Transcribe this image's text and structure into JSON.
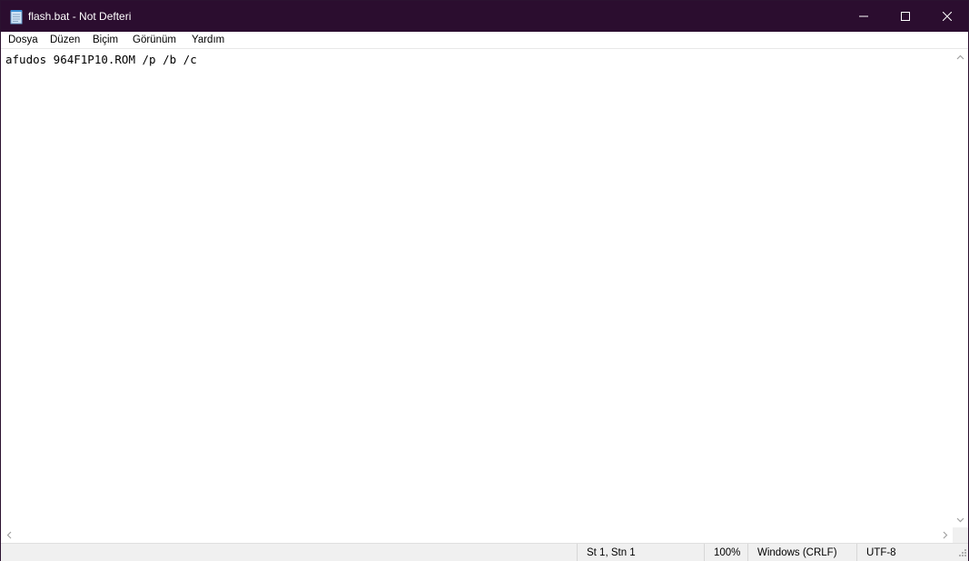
{
  "window": {
    "title": "flash.bat - Not Defteri",
    "icons": {
      "app": "notepad-icon",
      "minimize": "minimize-icon",
      "maximize": "maximize-icon",
      "close": "close-icon"
    },
    "colors": {
      "titlebar": "#2b0d2f",
      "statusbar": "#f0f0f0"
    }
  },
  "menu": {
    "items": [
      {
        "label": "Dosya"
      },
      {
        "label": "Düzen"
      },
      {
        "label": "Biçim"
      },
      {
        "label": "Görünüm"
      },
      {
        "label": "Yardım"
      }
    ]
  },
  "editor": {
    "text": "afudos 964F1P10.ROM /p /b /c"
  },
  "status": {
    "position": "St 1, Stn 1",
    "zoom": "100%",
    "line_ending": "Windows (CRLF)",
    "encoding": "UTF-8"
  }
}
